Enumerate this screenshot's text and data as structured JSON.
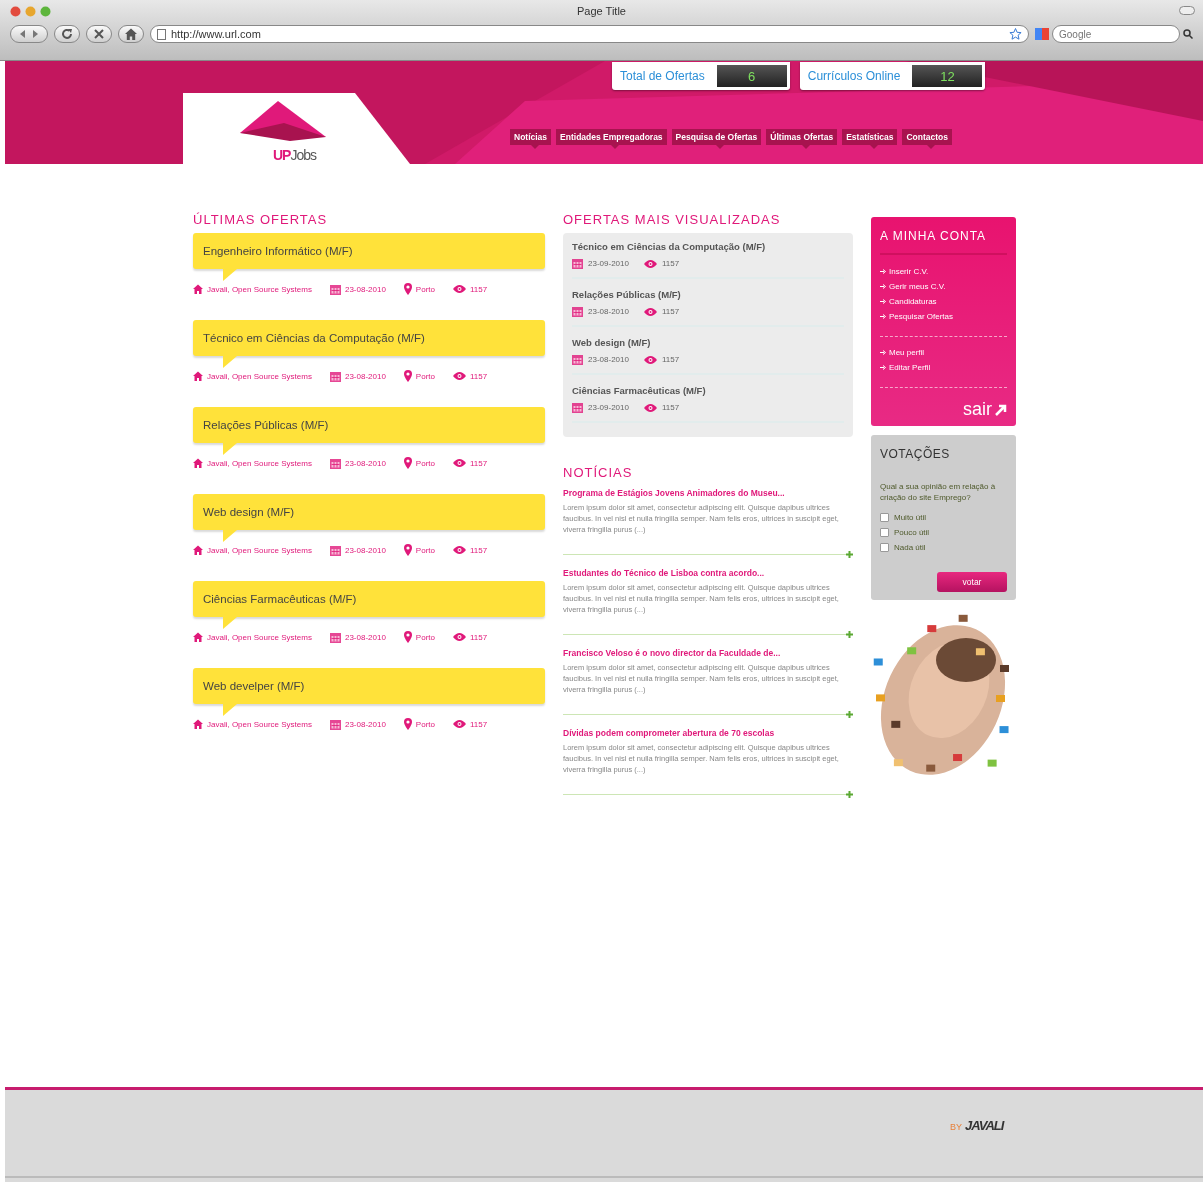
{
  "browser": {
    "title": "Page Title",
    "url": "http://www.url.com",
    "search_placeholder": "Google"
  },
  "header": {
    "logo": [
      "UP",
      "Jobs"
    ],
    "stats": [
      {
        "label": "Total de Ofertas",
        "value": "6"
      },
      {
        "label": "Currículos Online",
        "value": "12"
      }
    ],
    "nav": [
      "Notícias",
      "Entidades Empregadoras",
      "Pesquisa de Ofertas",
      "Últimas Ofertas",
      "Estatísticas",
      "Contactos"
    ]
  },
  "latest_offers": {
    "title": "ÚLTIMAS OFERTAS",
    "items": [
      {
        "title": "Engenheiro Informático (M/F)",
        "company": "Javali, Open Source Systems",
        "date": "23-08-2010",
        "location": "Porto",
        "views": "1157"
      },
      {
        "title": "Técnico em Ciências da Computação (M/F)",
        "company": "Javali, Open Source Systems",
        "date": "23-08-2010",
        "location": "Porto",
        "views": "1157"
      },
      {
        "title": "Relações Públicas (M/F)",
        "company": "Javali, Open Source Systems",
        "date": "23-08-2010",
        "location": "Porto",
        "views": "1157"
      },
      {
        "title": "Web design (M/F)",
        "company": "Javali, Open Source Systems",
        "date": "23-08-2010",
        "location": "Porto",
        "views": "1157"
      },
      {
        "title": "Ciências Farmacêuticas (M/F)",
        "company": "Javali, Open Source Systems",
        "date": "23-08-2010",
        "location": "Porto",
        "views": "1157"
      },
      {
        "title": "Web develper (M/F)",
        "company": "Javali, Open Source Systems",
        "date": "23-08-2010",
        "location": "Porto",
        "views": "1157"
      }
    ]
  },
  "most_viewed": {
    "title": "OFERTAS MAIS VISUALIZADAS",
    "items": [
      {
        "title": "Técnico em Ciências da Computação (M/F)",
        "date": "23-09-2010",
        "views": "1157"
      },
      {
        "title": "Relações Públicas (M/F)",
        "date": "23-08-2010",
        "views": "1157"
      },
      {
        "title": "Web design (M/F)",
        "date": "23-08-2010",
        "views": "1157"
      },
      {
        "title": "Ciências Farmacêuticas (M/F)",
        "date": "23-09-2010",
        "views": "1157"
      }
    ]
  },
  "news": {
    "title": "NOTÍCIAS",
    "items": [
      {
        "title": "Programa de Estágios Jovens Animadores do Museu...",
        "body": "Lorem ipsum dolor sit amet, consectetur adipiscing elit. Quisque dapibus ultrices faucibus. In vel nisl et nulla fringilla semper. Nam felis eros, ultrices in suscipit eget, viverra fringilla purus (...)"
      },
      {
        "title": "Estudantes do Técnico de Lisboa contra acordo...",
        "body": "Lorem ipsum dolor sit amet, consectetur adipiscing elit. Quisque dapibus ultrices faucibus. In vel nisl et nulla fringilla semper. Nam felis eros, ultrices in suscipit eget, viverra fringilla purus (...)"
      },
      {
        "title": "Francisco Veloso é o novo director da Faculdade de...",
        "body": "Lorem ipsum dolor sit amet, consectetur adipiscing elit. Quisque dapibus ultrices faucibus. In vel nisl et nulla fringilla semper. Nam felis eros, ultrices in suscipit eget, viverra fringilla purus (...)"
      },
      {
        "title": "Dívidas podem comprometer abertura de 70 escolas",
        "body": "Lorem ipsum dolor sit amet, consectetur adipiscing elit. Quisque dapibus ultrices faucibus. In vel nisl et nulla fringilla semper. Nam felis eros, ultrices in suscipit eget, viverra fringilla purus (...)"
      }
    ]
  },
  "account": {
    "title": "A MINHA CONTA",
    "groups": [
      [
        "Inserir C.V.",
        "Gerir meus C.V.",
        "Candidaturas",
        "Pesquisar Ofertas"
      ],
      [
        "Meu perfil",
        "Editar Perfil"
      ]
    ],
    "logout": "sair"
  },
  "poll": {
    "title": "VOTAÇÕES",
    "question": "Qual a sua opinião em relação à criação do site Emprego?",
    "options": [
      {
        "label": "Muito útil",
        "checked": false
      },
      {
        "label": "Pouco útil",
        "checked": false
      },
      {
        "label": "Nada útil",
        "checked": false
      }
    ],
    "button": "votar"
  },
  "footer": {
    "by": "BY",
    "brand": "JAVALI"
  }
}
